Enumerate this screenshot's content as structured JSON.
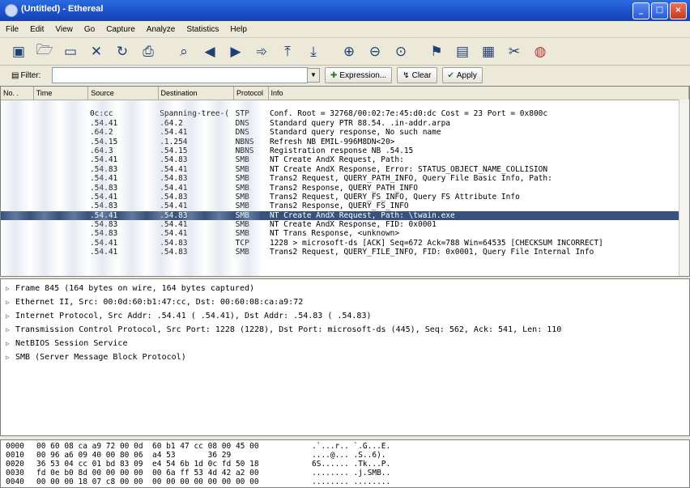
{
  "window": {
    "title": "(Untitled) - Ethereal",
    "buttons": [
      "_",
      "□",
      "×"
    ]
  },
  "menu": [
    "File",
    "Edit",
    "View",
    "Go",
    "Capture",
    "Analyze",
    "Statistics",
    "Help"
  ],
  "toolbar": [
    "interface-list-icon",
    "open-file-icon",
    "save-icon",
    "close-file-icon",
    "reload-icon",
    "print-icon",
    "find-packet-icon",
    "go-back-icon",
    "go-forward-icon",
    "go-to-packet-icon",
    "go-first-icon",
    "go-last-icon",
    "zoom-in-icon",
    "zoom-out-icon",
    "zoom-100-icon",
    "colorize-icon",
    "capture-filters-icon",
    "display-filters-icon",
    "coloring-rules-icon",
    "preferences-icon",
    "help-icon"
  ],
  "filter": {
    "label": "Filter:",
    "value": "",
    "expression": "Expression...",
    "clear": "Clear",
    "apply": "Apply"
  },
  "columns": {
    "no": "No. .",
    "time": "Time",
    "source": "Source",
    "destination": "Destination",
    "protocol": "Protocol",
    "info": "Info"
  },
  "packets": [
    {
      "no": "",
      "time": "",
      "src": "",
      "dst": "",
      "proto": "",
      "info": ""
    },
    {
      "no": "",
      "time": "",
      "src": "0c:cc",
      "dst": "Spanning-tree-(",
      "proto": "STP",
      "info": "Conf. Root = 32768/00:02:7e:45:d0:dc  Cost = 23  Port = 0x800c"
    },
    {
      "no": "",
      "time": "",
      "src": ".54.41",
      "dst": ".64.2",
      "proto": "DNS",
      "info": "Standard query PTR 88.54.       .in-addr.arpa"
    },
    {
      "no": "",
      "time": "",
      "src": ".64.2",
      "dst": ".54.41",
      "proto": "DNS",
      "info": "Standard query response, No such name"
    },
    {
      "no": "",
      "time": "",
      "src": ".54.15",
      "dst": ".1.254",
      "proto": "NBNS",
      "info": "Refresh NB EMIL-996M8DN<20>"
    },
    {
      "no": "",
      "time": "",
      "src": ".64.3",
      "dst": ".54.15",
      "proto": "NBNS",
      "info": "Registration response NB         .54.15"
    },
    {
      "no": "",
      "time": "",
      "src": ".54.41",
      "dst": ".54.83",
      "proto": "SMB",
      "info": "NT Create AndX Request, Path:"
    },
    {
      "no": "",
      "time": "",
      "src": ".54.83",
      "dst": ".54.41",
      "proto": "SMB",
      "info": "NT Create AndX Response, Error: STATUS_OBJECT_NAME_COLLISION"
    },
    {
      "no": "",
      "time": "",
      "src": ".54.41",
      "dst": ".54.83",
      "proto": "SMB",
      "info": "Trans2 Request, QUERY_PATH_INFO, Query File Basic Info, Path:"
    },
    {
      "no": "",
      "time": "",
      "src": ".54.83",
      "dst": ".54.41",
      "proto": "SMB",
      "info": "Trans2 Response, QUERY_PATH_INFO"
    },
    {
      "no": "",
      "time": "",
      "src": ".54.41",
      "dst": ".54.83",
      "proto": "SMB",
      "info": "Trans2 Request, QUERY_FS_INFO, Query FS Attribute Info"
    },
    {
      "no": "",
      "time": "",
      "src": ".54.83",
      "dst": ".54.41",
      "proto": "SMB",
      "info": "Trans2 Response, QUERY_FS_INFO"
    },
    {
      "no": "",
      "time": "",
      "src": ".54.41",
      "dst": ".54.83",
      "proto": "SMB",
      "info": "NT Create AndX Request, Path: \\twain.exe",
      "selected": true
    },
    {
      "no": "",
      "time": "",
      "src": ".54.83",
      "dst": ".54.41",
      "proto": "SMB",
      "info": "NT Create AndX Response, FID: 0x0001"
    },
    {
      "no": "",
      "time": "",
      "src": ".54.83",
      "dst": ".54.41",
      "proto": "SMB",
      "info": "NT Trans Response, <unknown>"
    },
    {
      "no": "",
      "time": "",
      "src": ".54.41",
      "dst": ".54.83",
      "proto": "TCP",
      "info": "1228 > microsoft-ds [ACK] Seq=672 Ack=788 Win=64535 [CHECKSUM INCORRECT]"
    },
    {
      "no": "",
      "time": "",
      "src": ".54.41",
      "dst": ".54.83",
      "proto": "SMB",
      "info": "Trans2 Request, QUERY_FILE_INFO, FID: 0x0001, Query File Internal Info"
    },
    {
      "no": "",
      "time": "",
      "src": "",
      "dst": "",
      "proto": "",
      "info": ""
    }
  ],
  "details": [
    "Frame 845 (164 bytes on wire, 164 bytes captured)",
    "Ethernet II, Src: 00:0d:60:b1:47:cc, Dst: 00:60:08:ca:a9:72",
    "Internet Protocol, Src Addr:        .54.41 (        .54.41), Dst Addr:        .54.83 (        .54.83)",
    "Transmission Control Protocol, Src Port: 1228 (1228), Dst Port: microsoft-ds (445), Seq: 562, Ack: 541, Len: 110",
    "NetBIOS Session Service",
    "SMB (Server Message Block Protocol)"
  ],
  "hex": [
    {
      "off": "0000",
      "bytes": "00 60 08 ca a9 72 00 0d  60 b1 47 cc 08 00 45 00",
      "ascii": ".`...r.. `.G...E."
    },
    {
      "off": "0010",
      "bytes": "00 96 a6 09 40 00 80 06  a4 53       36 29      ",
      "ascii": "....@... .S..6)."
    },
    {
      "off": "0020",
      "bytes": "36 53 04 cc 01 bd 83 09  e4 54 6b 1d 0c fd 50 18",
      "ascii": "6S...... .Tk...P."
    },
    {
      "off": "0030",
      "bytes": "fd 0e b0 8d 00 00 00 00  00 6a ff 53 4d 42 a2 00",
      "ascii": "........ .j.SMB.."
    },
    {
      "off": "0040",
      "bytes": "00 00 00 18 07 c8 00 00  00 00 00 00 00 00 00 00",
      "ascii": "........ ........"
    }
  ]
}
